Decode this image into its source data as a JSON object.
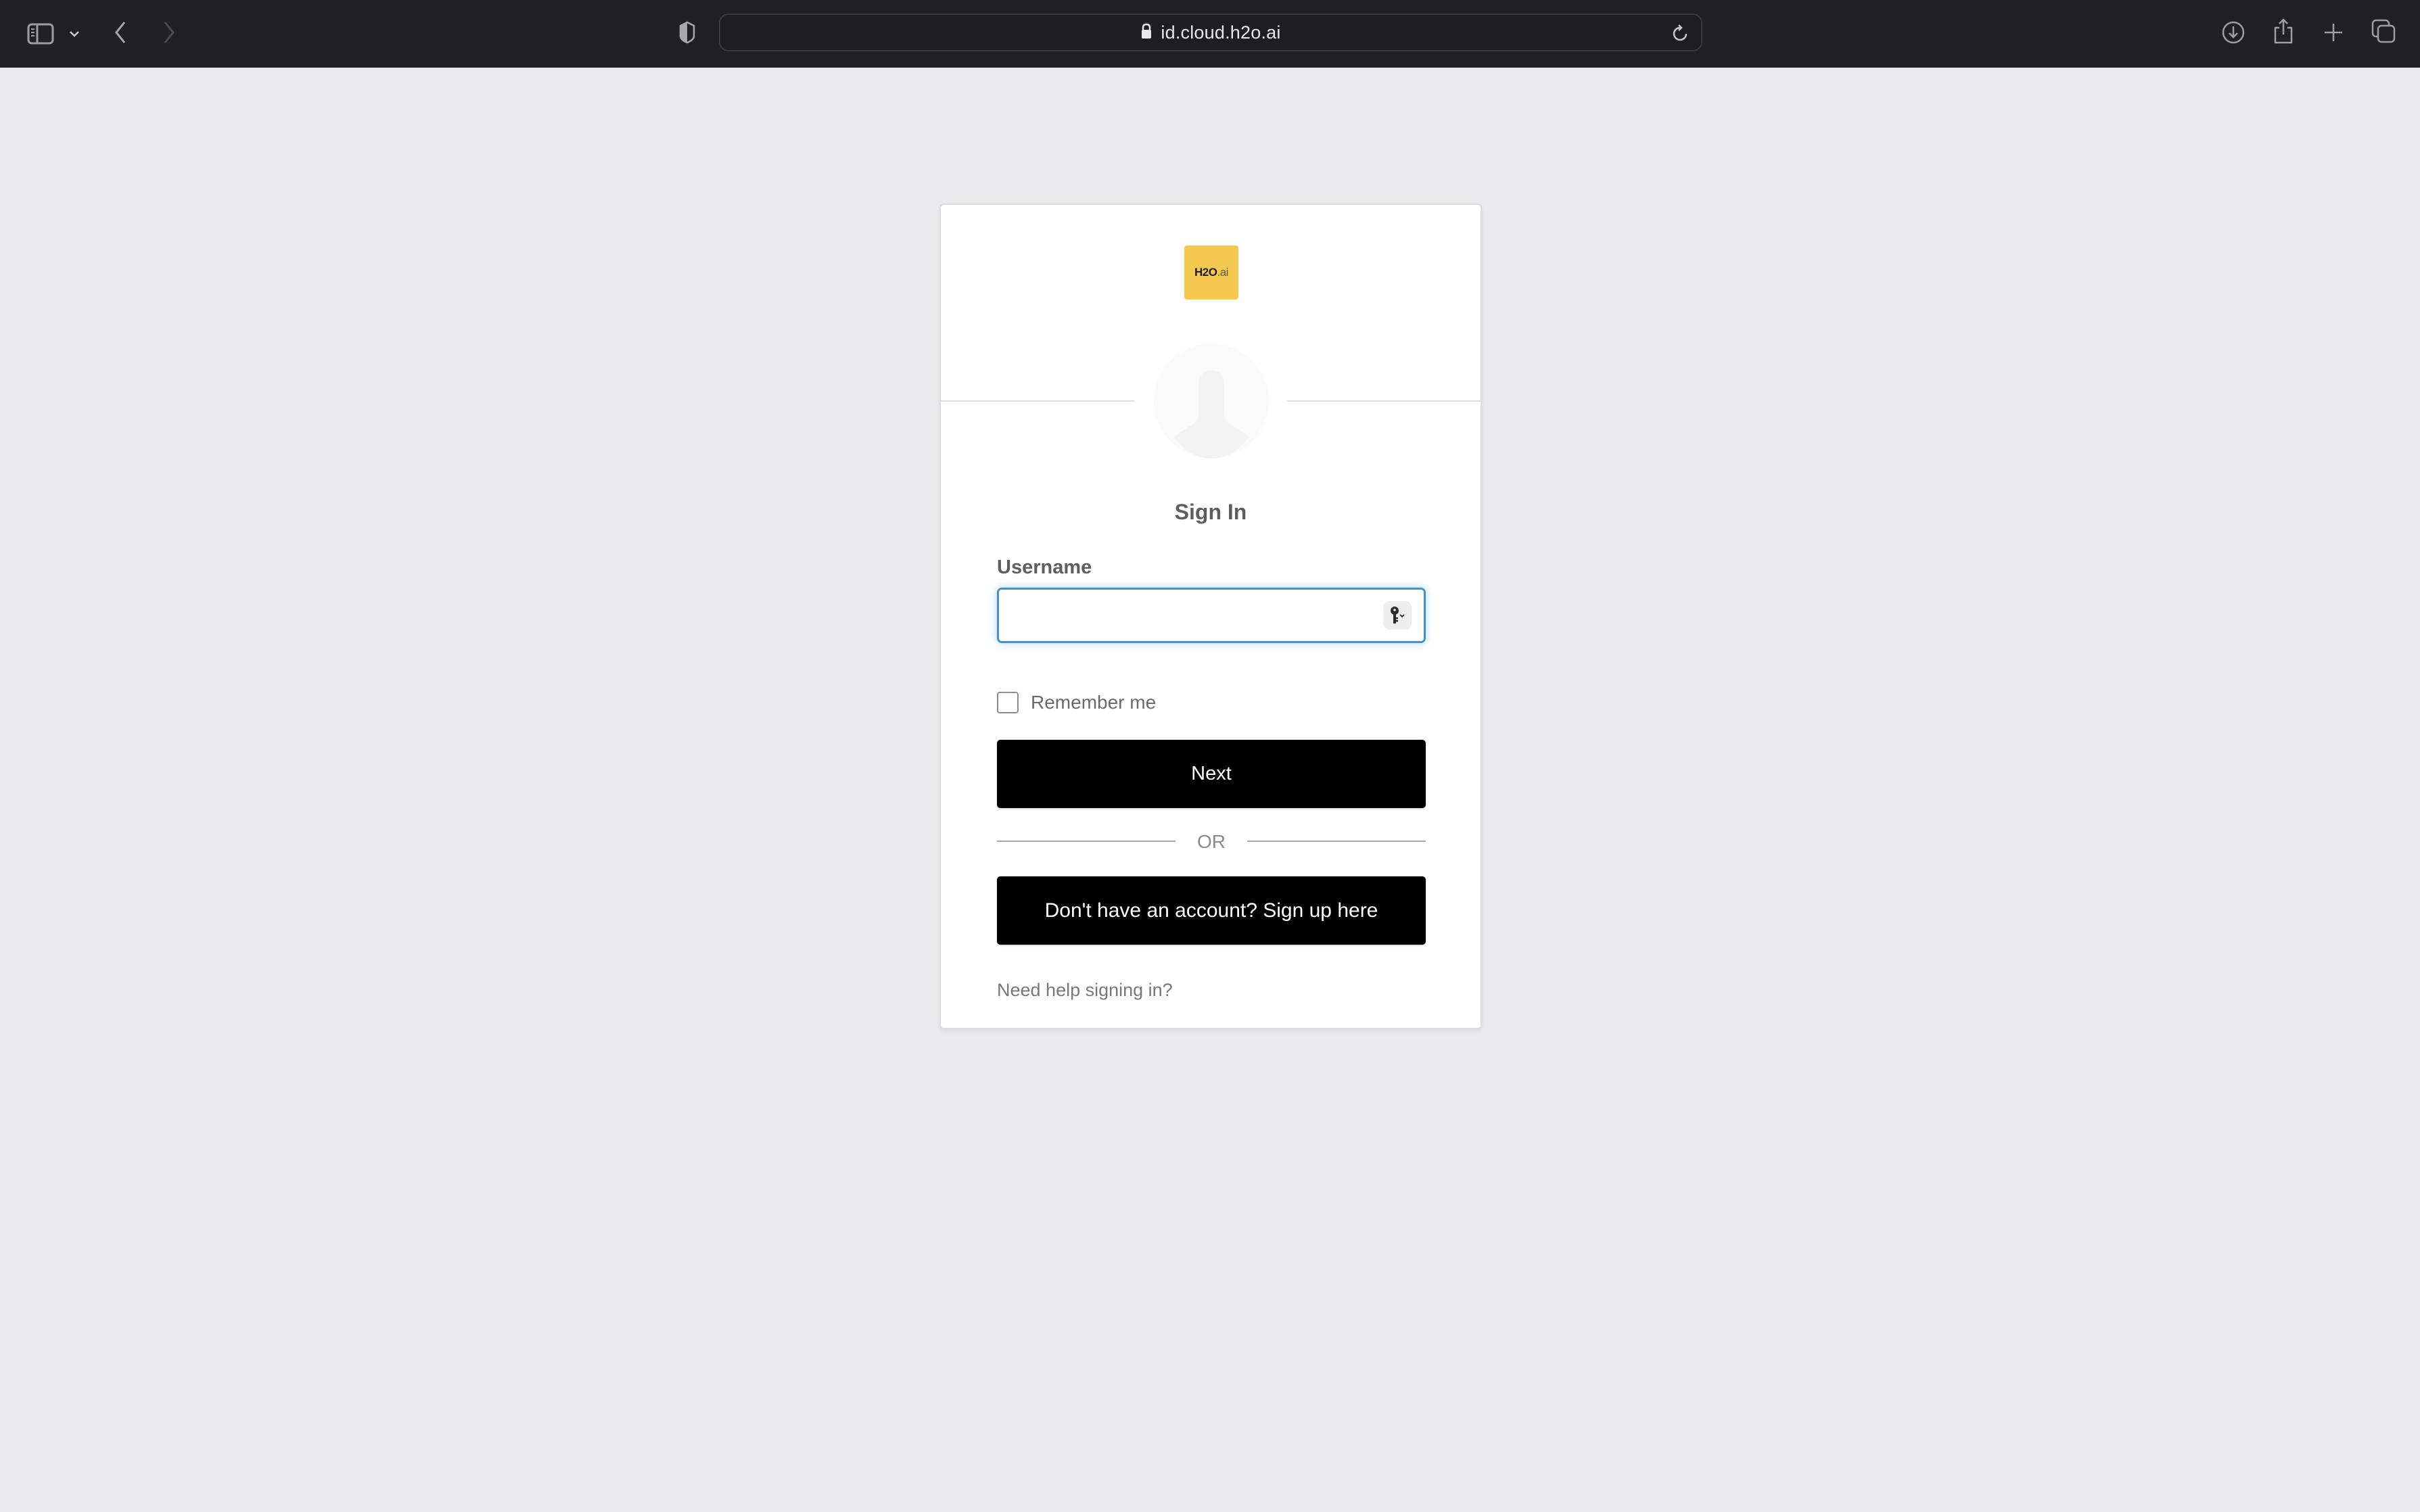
{
  "browser": {
    "url": "id.cloud.h2o.ai",
    "icons": {
      "sidebar": "sidebar-icon",
      "sidebar_menu": "chevron-down-icon",
      "back": "back-chevron-icon",
      "forward": "forward-chevron-icon",
      "privacy": "shield-icon",
      "lock": "lock-icon",
      "reload": "reload-icon",
      "downloads": "download-icon",
      "share": "share-icon",
      "new_tab": "plus-icon",
      "tabs": "tab-overview-icon"
    }
  },
  "login": {
    "logo": {
      "main": "H2O",
      "suffix": ".ai",
      "color": "#f5c94f"
    },
    "title": "Sign In",
    "username_label": "Username",
    "username_value": "",
    "remember_label": "Remember me",
    "remember_checked": false,
    "next_label": "Next",
    "or_label": "OR",
    "signup_label": "Don't have an account? Sign up here",
    "help_label": "Need help signing in?"
  },
  "colors": {
    "toolbar_bg": "#212024",
    "page_bg": "#eaeaec",
    "button_bg": "#000000",
    "focus_border": "#4a90c8"
  }
}
